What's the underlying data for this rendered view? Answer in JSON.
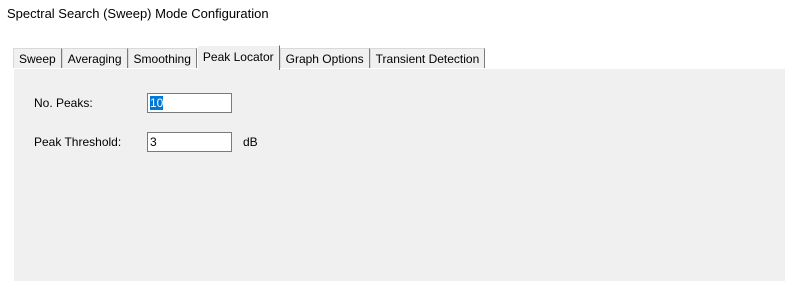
{
  "window": {
    "title": "Spectral Search (Sweep) Mode Configuration"
  },
  "tabs": [
    {
      "label": "Sweep",
      "active": false
    },
    {
      "label": "Averaging",
      "active": false
    },
    {
      "label": "Smoothing",
      "active": false
    },
    {
      "label": "Peak Locator",
      "active": true
    },
    {
      "label": "Graph Options",
      "active": false
    },
    {
      "label": "Transient Detection",
      "active": false
    }
  ],
  "peak_locator": {
    "no_peaks_label": "No. Peaks:",
    "no_peaks_value": "10",
    "threshold_label": "Peak Threshold:",
    "threshold_value": "3",
    "threshold_unit": "dB"
  },
  "colors": {
    "selection": "#0078d7",
    "panel_bg": "#f0f0f0"
  }
}
